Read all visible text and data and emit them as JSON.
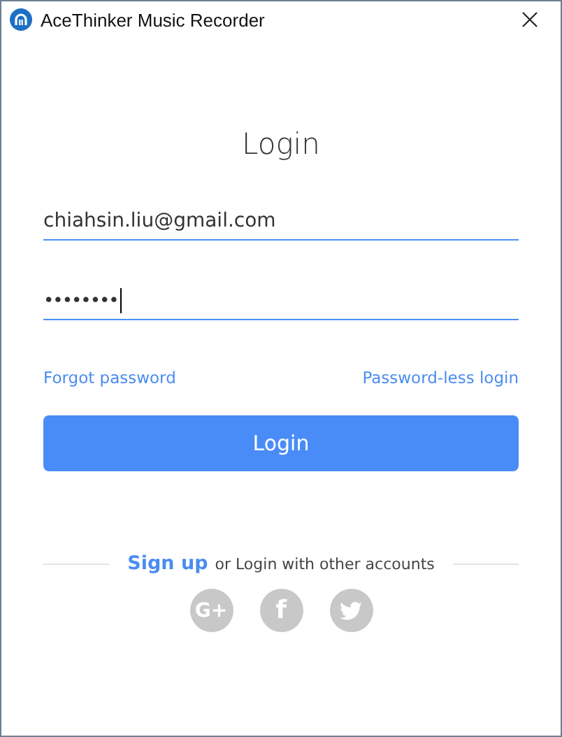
{
  "window": {
    "title": "AceThinker Music Recorder"
  },
  "heading": "Login",
  "email": {
    "value": "chiahsin.liu@gmail.com",
    "focused": false
  },
  "password": {
    "value": "••••••••",
    "focused": true
  },
  "links": [
    "Forgot password",
    "Password-less login"
  ],
  "login_button": "Login",
  "signup": {
    "link": "Sign up",
    "text": "or Login with other accounts"
  },
  "social": [
    {
      "kind": "google",
      "label": "G+"
    },
    {
      "kind": "facebook",
      "label": "f"
    },
    {
      "kind": "twitter"
    }
  ]
}
